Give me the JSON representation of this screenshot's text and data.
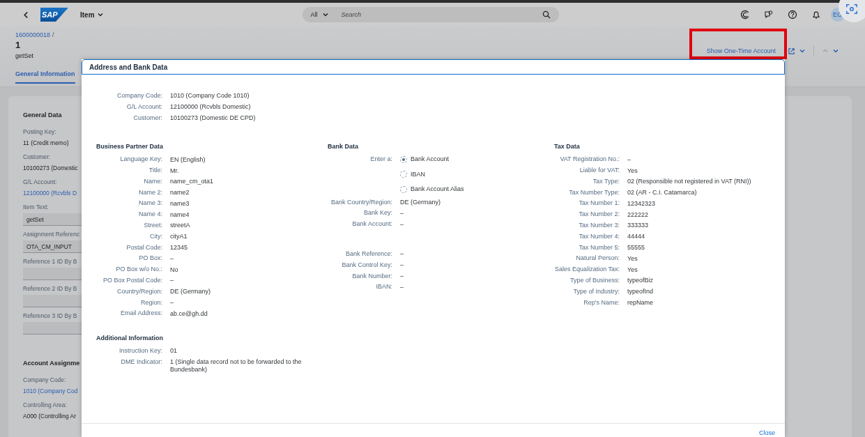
{
  "shell": {
    "logo": "SAP",
    "title": "Item",
    "search": {
      "scope": "All",
      "placeholder": "Search"
    },
    "avatar": "EG"
  },
  "header": {
    "breadcrumb": "1600000018",
    "breadcrumb_separator": "/",
    "title": "1",
    "subtitle": "getSet",
    "action_link": "Show One-Time Account",
    "tabs": [
      {
        "label": "General Information",
        "selected": true
      }
    ]
  },
  "background_form": {
    "sections": [
      {
        "title": "General Data",
        "fields": [
          {
            "label": "Posting Key:",
            "value": "11 (Credit memo)",
            "kind": "text"
          },
          {
            "label": "Customer:",
            "value": "10100273 (Domestic",
            "kind": "text"
          },
          {
            "label": "G/L Account:",
            "value": "12100000 (Rcvbls D",
            "kind": "link"
          },
          {
            "label": "Item Text:",
            "value": "getSet",
            "kind": "input"
          },
          {
            "label": "Assignment Referenc",
            "value": "OTA_CM_INPUT",
            "kind": "input"
          },
          {
            "label": "Reference 1 ID By B",
            "kind": "input"
          },
          {
            "label": "Reference 2 ID By B",
            "kind": "input"
          },
          {
            "label": "Reference 3 ID By B",
            "kind": "input"
          }
        ]
      },
      {
        "title": "Account Assignme",
        "fields": [
          {
            "label": "Company Code:",
            "value": "1010 (Company Cod",
            "kind": "link"
          },
          {
            "label": "Controlling Area:",
            "value": "A000 (Controlling Ar",
            "kind": "text"
          }
        ]
      }
    ]
  },
  "dialog": {
    "title": "Address and Bank Data",
    "summary": [
      {
        "label": "Company Code:",
        "value": "1010 (Company Code 1010)"
      },
      {
        "label": "G/L Account:",
        "value": "12100000 (Rcvbls Domestic)"
      },
      {
        "label": "Customer:",
        "value": "10100273 (Domestic DE CPD)"
      }
    ],
    "columns": [
      {
        "sections": [
          {
            "title": "Business Partner Data",
            "groups": [
              [
                {
                  "label": "Language Key:",
                  "value": "EN (English)",
                  "kind": "text"
                },
                {
                  "label": "Title:",
                  "value": "Mr.",
                  "kind": "text"
                },
                {
                  "label": "Name:",
                  "value": "name_cm_ota1",
                  "kind": "text"
                },
                {
                  "label": "Name 2:",
                  "value": "name2",
                  "kind": "text"
                },
                {
                  "label": "Name 3:",
                  "value": "name3",
                  "kind": "text"
                },
                {
                  "label": "Name 4:",
                  "value": "name4",
                  "kind": "text"
                },
                {
                  "label": "Street:",
                  "value": "streetA",
                  "kind": "text"
                },
                {
                  "label": "City:",
                  "value": "cityA1",
                  "kind": "text"
                },
                {
                  "label": "Postal Code:",
                  "value": "12345",
                  "kind": "text"
                },
                {
                  "label": "PO Box:",
                  "value": "–",
                  "kind": "text"
                },
                {
                  "label": "PO Box w/o No.:",
                  "value": "No",
                  "kind": "text"
                },
                {
                  "label": "PO Box Postal Code:",
                  "value": "–",
                  "kind": "text"
                },
                {
                  "label": "Country/Region:",
                  "value": "DE (Germany)",
                  "kind": "text"
                },
                {
                  "label": "Region:",
                  "value": "–",
                  "kind": "text"
                },
                {
                  "label": "Email Address:",
                  "value": "ab.ce@gh.dd",
                  "kind": "text"
                }
              ]
            ]
          },
          {
            "title": "Additional Information",
            "groups": [
              [
                {
                  "label": "Instruction Key:",
                  "value": "01",
                  "kind": "text"
                },
                {
                  "label": "DME Indicator:",
                  "value": "1 (Single data record not to be forwarded to the Bundesbank)",
                  "kind": "text"
                }
              ]
            ]
          }
        ]
      },
      {
        "sections": [
          {
            "title": "Bank Data",
            "groups": [
              [
                {
                  "label": "Enter a:",
                  "kind": "radio",
                  "options": [
                    {
                      "label": "Bank Account",
                      "selected": true
                    },
                    {
                      "label": "IBAN",
                      "selected": false
                    },
                    {
                      "label": "Bank Account Alias",
                      "selected": false
                    }
                  ]
                },
                {
                  "label": "Bank Country/Region:",
                  "value": "DE (Germany)",
                  "kind": "text"
                },
                {
                  "label": "Bank Key:",
                  "value": "–",
                  "kind": "text"
                },
                {
                  "label": "Bank Account:",
                  "value": "–",
                  "kind": "text"
                }
              ],
              [
                {
                  "label": "Bank Reference:",
                  "value": "–",
                  "kind": "text"
                },
                {
                  "label": "Bank Control Key:",
                  "value": "–",
                  "kind": "text"
                },
                {
                  "label": "Bank Number:",
                  "value": "–",
                  "kind": "text"
                },
                {
                  "label": "IBAN:",
                  "value": "–",
                  "kind": "text"
                }
              ]
            ]
          }
        ]
      },
      {
        "sections": [
          {
            "title": "Tax Data",
            "groups": [
              [
                {
                  "label": "VAT Registration No.:",
                  "value": "–",
                  "kind": "text"
                },
                {
                  "label": "Liable for VAT:",
                  "value": "Yes",
                  "kind": "text"
                },
                {
                  "label": "Tax Type:",
                  "value": "02 (Responsible not registered in VAT (RNI))",
                  "kind": "text"
                },
                {
                  "label": "Tax Number Type:",
                  "value": "02 (AR - C.I. Catamarca)",
                  "kind": "text"
                },
                {
                  "label": "Tax Number 1:",
                  "value": "12342323",
                  "kind": "text"
                },
                {
                  "label": "Tax Number 2:",
                  "value": "222222",
                  "kind": "text"
                },
                {
                  "label": "Tax Number 3:",
                  "value": "333333",
                  "kind": "text"
                },
                {
                  "label": "Tax Number 4:",
                  "value": "44444",
                  "kind": "text"
                },
                {
                  "label": "Tax Number 5:",
                  "value": "55555",
                  "kind": "text"
                },
                {
                  "label": "Natural Person:",
                  "value": "Yes",
                  "kind": "text"
                },
                {
                  "label": "Sales Equalization Tax:",
                  "value": "Yes",
                  "kind": "text"
                },
                {
                  "label": "Type of Business:",
                  "value": "typeofBiz",
                  "kind": "text"
                },
                {
                  "label": "Type of Industry:",
                  "value": "typeofInd",
                  "kind": "text"
                },
                {
                  "label": "Rep's Name:",
                  "value": "repName",
                  "kind": "text"
                }
              ]
            ]
          }
        ]
      }
    ],
    "close": "Close"
  }
}
